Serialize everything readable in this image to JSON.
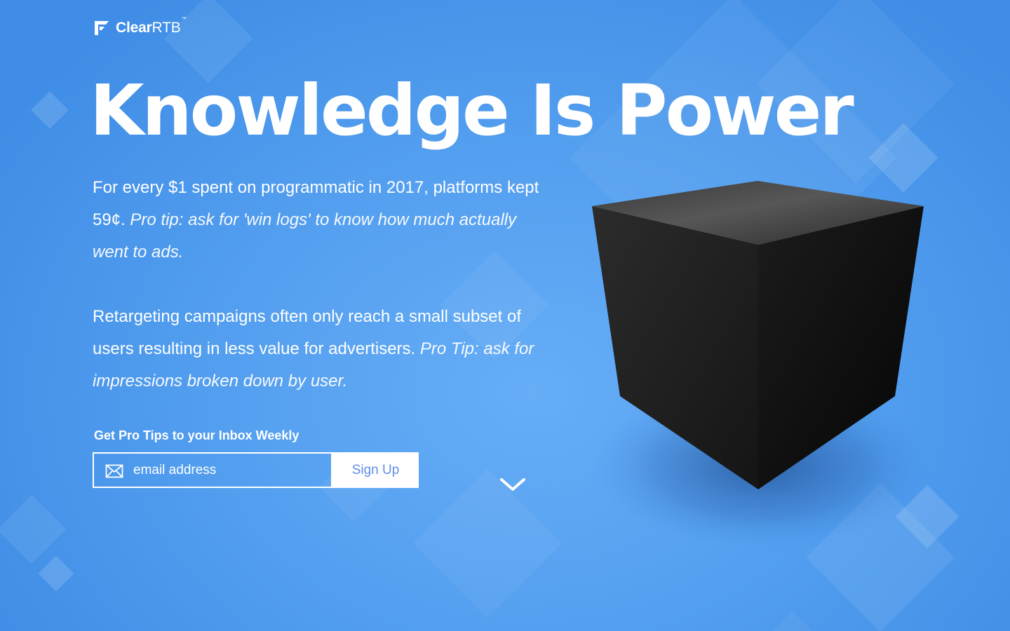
{
  "brand": {
    "name_bold": "Clear",
    "name_light": "RTB",
    "trademark": "™"
  },
  "hero": {
    "headline": "Knowledge Is Power",
    "paragraph_1": {
      "text": "For every $1 spent on programmatic in 2017, platforms kept 59¢.",
      "tip": "Pro tip: ask for 'win logs' to know how much actually went to ads."
    },
    "paragraph_2": {
      "text": "Retargeting campaigns often only reach a small subset of users resulting in less value for advertisers.",
      "tip": "Pro Tip: ask for impressions broken down by user."
    }
  },
  "signup": {
    "label": "Get Pro Tips to your Inbox Weekly",
    "email_placeholder": "email address",
    "email_value": "",
    "button_label": "Sign Up"
  },
  "icons": {
    "logo": "clearrtb-logo-icon",
    "mail": "envelope-icon",
    "scroll": "chevron-down-icon"
  },
  "colors": {
    "background": "#55a0f0",
    "background_edge": "#3f8de6",
    "text": "#ffffff",
    "button_text": "#5f8ee8",
    "cube": "#1e1e1e"
  }
}
